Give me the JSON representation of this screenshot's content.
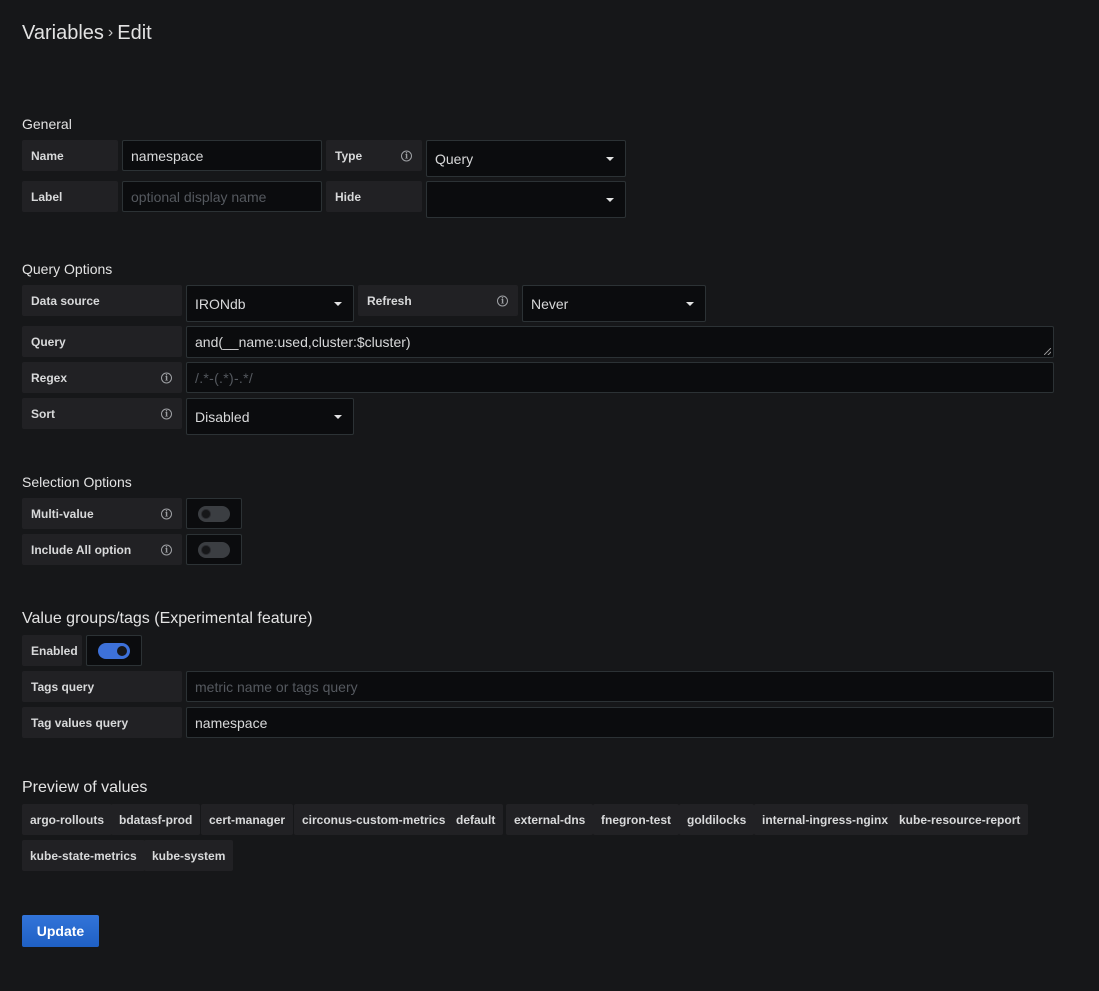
{
  "header": {
    "title_part1": "Variables",
    "separator": "›",
    "title_part2": "Edit"
  },
  "general": {
    "heading": "General",
    "name_label": "Name",
    "name_value": "namespace",
    "type_label": "Type",
    "type_value": "Query",
    "label_label": "Label",
    "label_placeholder": "optional display name",
    "hide_label": "Hide",
    "hide_value": ""
  },
  "query_options": {
    "heading": "Query Options",
    "datasource_label": "Data source",
    "datasource_value": "IRONdb",
    "refresh_label": "Refresh",
    "refresh_value": "Never",
    "query_label": "Query",
    "query_value": "and(__name:used,cluster:$cluster)",
    "regex_label": "Regex",
    "regex_placeholder": "/.*-(.*)-.*/",
    "sort_label": "Sort",
    "sort_value": "Disabled"
  },
  "selection_options": {
    "heading": "Selection Options",
    "multi_value_label": "Multi-value",
    "multi_value_on": false,
    "include_all_label": "Include All option",
    "include_all_on": false
  },
  "value_groups": {
    "heading": "Value groups/tags (Experimental feature)",
    "enabled_label": "Enabled",
    "enabled_on": true,
    "tags_query_label": "Tags query",
    "tags_query_placeholder": "metric name or tags query",
    "tag_values_query_label": "Tag values query",
    "tag_values_query_value": "namespace"
  },
  "preview": {
    "heading": "Preview of values",
    "values": [
      "argo-rollouts",
      "bdatasf-prod",
      "cert-manager",
      "circonus-custom-metrics",
      "default",
      "external-dns",
      "fnegron-test",
      "goldilocks",
      "internal-ingress-nginx",
      "kube-resource-report",
      "kube-state-metrics",
      "kube-system"
    ]
  },
  "actions": {
    "update_label": "Update"
  },
  "colors": {
    "background": "#161719",
    "label_bg": "#212124",
    "input_bg": "#0b0c0e",
    "accent": "#3274d9"
  }
}
